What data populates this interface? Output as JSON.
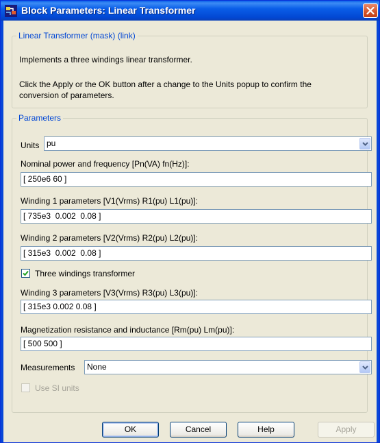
{
  "window": {
    "title": "Block Parameters: Linear Transformer"
  },
  "description": {
    "group_title": "Linear Transformer (mask) (link)",
    "line1": "Implements a three windings linear transformer.",
    "line2a": "Click the Apply or the OK button after a change to the Units popup to confirm the",
    "line2b": "conversion of parameters."
  },
  "parameters": {
    "group_title": "Parameters",
    "units_label": "Units",
    "units_value": "pu",
    "nominal_label": "Nominal power and frequency [Pn(VA) fn(Hz)]:",
    "nominal_value": "[ 250e6 60 ]",
    "w1_label": "Winding 1 parameters [V1(Vrms) R1(pu) L1(pu)]:",
    "w1_value": "[ 735e3  0.002  0.08 ]",
    "w2_label": "Winding 2 parameters [V2(Vrms) R2(pu) L2(pu)]:",
    "w2_value": "[ 315e3  0.002  0.08 ]",
    "three_windings_label": "Three windings transformer",
    "three_windings_checked": true,
    "w3_label": "Winding 3 parameters [V3(Vrms) R3(pu) L3(pu)]:",
    "w3_value": "[ 315e3 0.002 0.08 ]",
    "mag_label": "Magnetization resistance and inductance [Rm(pu) Lm(pu)]:",
    "mag_value": "[ 500 500 ]",
    "measurements_label": "Measurements",
    "measurements_value": "None",
    "si_units_label": "Use SI units",
    "si_units_checked": false
  },
  "buttons": {
    "ok": "OK",
    "cancel": "Cancel",
    "help": "Help",
    "apply": "Apply"
  }
}
